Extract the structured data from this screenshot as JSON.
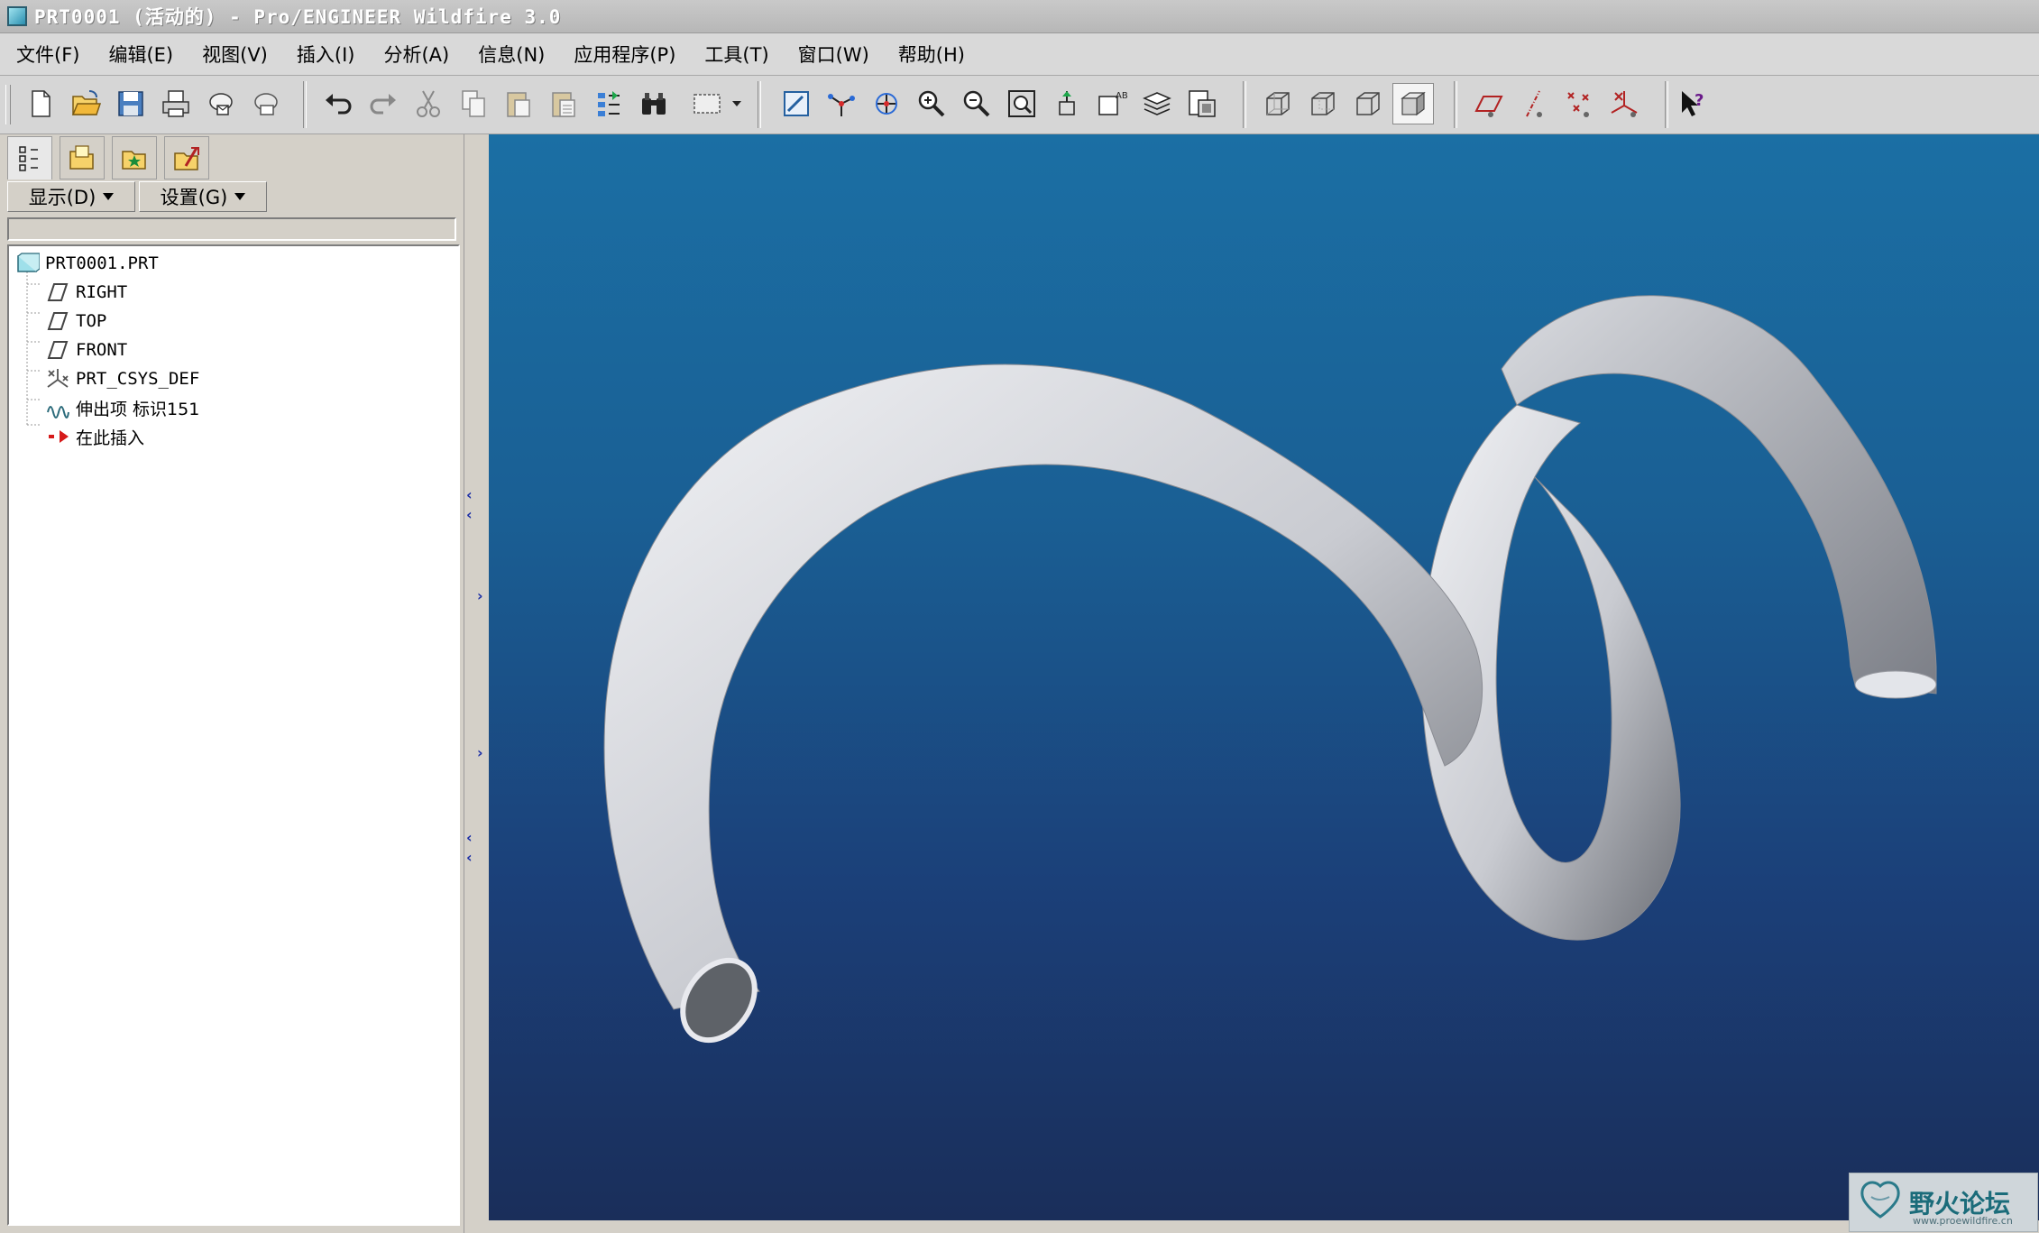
{
  "window": {
    "title": "PRT0001 (活动的) - Pro/ENGINEER Wildfire 3.0"
  },
  "menubar": [
    "文件(F)",
    "编辑(E)",
    "视图(V)",
    "插入(I)",
    "分析(A)",
    "信息(N)",
    "应用程序(P)",
    "工具(T)",
    "窗口(W)",
    "帮助(H)"
  ],
  "toolbar": {
    "buttons": [
      {
        "name": "new-file-icon"
      },
      {
        "name": "open-file-icon"
      },
      {
        "name": "save-icon"
      },
      {
        "name": "print-icon"
      },
      {
        "name": "send-mail-icon"
      },
      {
        "name": "send-mail-attachment-icon"
      },
      {
        "name": "undo-icon"
      },
      {
        "name": "redo-icon"
      },
      {
        "name": "cut-icon"
      },
      {
        "name": "copy-icon"
      },
      {
        "name": "paste-icon"
      },
      {
        "name": "paste-special-icon"
      },
      {
        "name": "regenerate-icon"
      },
      {
        "name": "find-icon"
      },
      {
        "name": "selection-box-icon"
      },
      {
        "name": "repaint-icon"
      },
      {
        "name": "spin-center-icon"
      },
      {
        "name": "orient-mode-icon"
      },
      {
        "name": "zoom-in-icon"
      },
      {
        "name": "zoom-out-icon"
      },
      {
        "name": "refit-icon"
      },
      {
        "name": "reorient-icon"
      },
      {
        "name": "saved-views-icon"
      },
      {
        "name": "layers-icon"
      },
      {
        "name": "view-manager-icon"
      },
      {
        "name": "wireframe-icon"
      },
      {
        "name": "hidden-line-icon"
      },
      {
        "name": "no-hidden-icon"
      },
      {
        "name": "shading-icon"
      },
      {
        "name": "datum-plane-display-icon"
      },
      {
        "name": "datum-axis-display-icon"
      },
      {
        "name": "datum-point-display-icon"
      },
      {
        "name": "coordinate-system-display-icon"
      },
      {
        "name": "context-help-icon"
      }
    ]
  },
  "panel": {
    "tabs": [
      "model-tree-tab-icon",
      "folder-browser-tab-icon",
      "favorites-tab-icon",
      "connections-tab-icon"
    ],
    "display_button": "显示(D)",
    "settings_button": "设置(G)",
    "tree": [
      {
        "label": "PRT0001.PRT",
        "icon": "part-icon",
        "level": 0
      },
      {
        "label": "RIGHT",
        "icon": "datum-plane-icon",
        "level": 1
      },
      {
        "label": "TOP",
        "icon": "datum-plane-icon",
        "level": 1
      },
      {
        "label": "FRONT",
        "icon": "datum-plane-icon",
        "level": 1
      },
      {
        "label": "PRT_CSYS_DEF",
        "icon": "coordinate-system-icon",
        "level": 1
      },
      {
        "label": "伸出项 标识151",
        "icon": "protrusion-icon",
        "level": 1
      },
      {
        "label": "在此插入",
        "icon": "insert-here-arrow-icon",
        "level": 1
      }
    ]
  },
  "watermark": {
    "text": "野火论坛",
    "url": "www.proewildfire.cn"
  },
  "colors": {
    "viewport_top": "#1b6fa4",
    "viewport_bottom": "#1a2e5a",
    "spring_highlight": "#f2f3f6",
    "spring_shadow": "#6d7077"
  }
}
